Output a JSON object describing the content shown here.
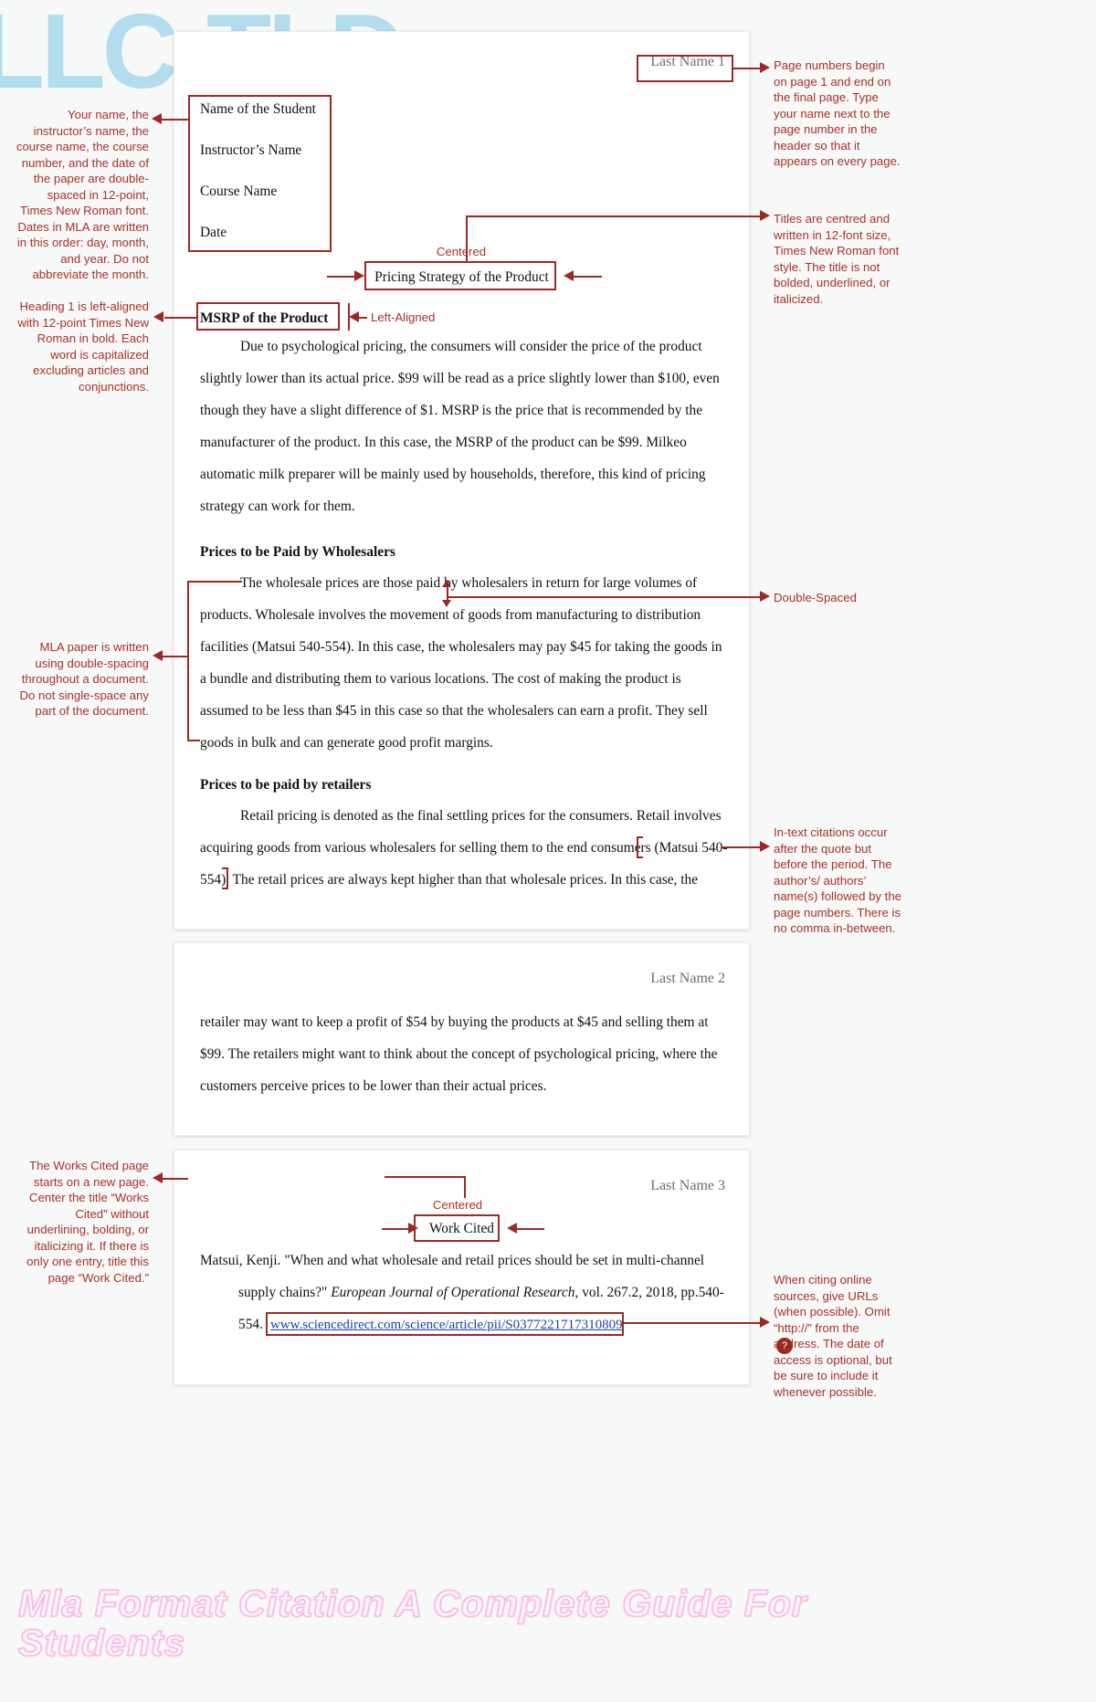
{
  "watermarks": {
    "left_logo": "LLC-TLD",
    "bottom_title": "Mla Format Citation A Complete Guide For Students"
  },
  "colors": {
    "annotation": "#a93226",
    "box_stroke": "#9c2a22",
    "link": "#1a3fb0",
    "watermark_left": "#b3dcec",
    "watermark_bottom": "#f9b9e6",
    "page_bg": "#ffffff",
    "canvas_bg": "#f7f8f8"
  },
  "page1": {
    "header": "Last Name 1",
    "heading_block": [
      "Name of the Student",
      "Instructor’s Name",
      "Course Name",
      "Date"
    ],
    "title": "Pricing Strategy of the Product",
    "h1": "MSRP of the Product",
    "body1": [
      "Due to psychological pricing, the consumers will consider the price of the product",
      "slightly lower than its actual price. $99 will be read as a price slightly lower than $100, even",
      "though they have a slight difference of $1. MSRP is the price that is recommended by the",
      "manufacturer of the product. In this case, the MSRP of the product can be $99. Milkeo",
      "automatic milk preparer will be mainly used by households, therefore, this kind of pricing",
      "strategy can work for them."
    ],
    "h2": "Prices to be Paid by Wholesalers",
    "body2": [
      "The wholesale prices are those paid by wholesalers in return for large volumes of",
      "products. Wholesale involves the movement of goods from manufacturing to distribution",
      "facilities (Matsui 540-554). In this case, the wholesalers may pay $45 for taking the goods in",
      "a bundle and distributing them to various locations. The cost of making the product is",
      "assumed to be less than $45 in this case so that the wholesalers can earn a profit. They sell",
      "goods in bulk and can generate good profit margins."
    ],
    "h3": "Prices to be paid by retailers",
    "body3": [
      "Retail pricing is denoted as the final settling prices for the consumers. Retail involves",
      "acquiring goods from various wholesalers for selling them to the end consumers (Matsui 540-",
      "554). The retail prices are always kept higher than that wholesale prices. In this case, the"
    ]
  },
  "page2": {
    "header": "Last Name 2",
    "body": [
      "retailer may want to keep a profit of $54 by buying the products at $45 and selling them at",
      "$99. The retailers might want to think about the concept of psychological pricing, where the",
      "customers perceive prices to be lower than their actual prices."
    ]
  },
  "page3": {
    "header": "Last Name 3",
    "title": "Work Cited",
    "citation_line1": "Matsui, Kenji. \"When and what wholesale and retail prices should be set in multi-channel",
    "citation_line2_a": "supply chains?\" ",
    "citation_line2_italic": "European Journal of Operational Research",
    "citation_line2_b": ", vol. 267.2, 2018, pp.540-",
    "citation_line3_prefix": "554.",
    "citation_url": "www.sciencedirect.com/science/article/pii/S0377221717310809"
  },
  "annotations": {
    "heading_info": "Your name, the instructor’s name, the course name, the course number, and the date of the paper are double-spaced in 12-point, Times New Roman font. Dates in MLA are written in this order: day, month, and year. Do not abbreviate the month.",
    "page_numbers": "Page numbers begin on page 1 and end on the final page. Type your name next to the page number in the header so that it appears on every page.",
    "titles": "Titles are centred and written in 12-font size, Times New Roman font style. The title is not bolded, underlined, or italicized.",
    "centered_label": "Centered",
    "heading1": "Heading 1 is left-aligned with 12-point Times New Roman in bold. Each word is capitalized excluding articles and conjunctions.",
    "left_aligned_label": "Left-Aligned",
    "double_spaced_label": "Double-Spaced",
    "double_spacing": "MLA paper is written using double-spacing throughout a document. Do not single-space any part of the document.",
    "in_text_citations": "In-text citations occur after the quote but before the period. The author’s/ authors’ name(s) followed by the page numbers. There is no comma in-between.",
    "works_cited": "The Works Cited page starts on a new page. Center the title “Works Cited” without underlining, bolding, or italicizing it. If there is only one entry, title this page “Work Cited.”",
    "centered_label2": "Centered",
    "urls": "When citing online sources, give URLs (when possible). Omit “http://” from the address. The date of access is optional, but be sure to include it whenever possible."
  }
}
